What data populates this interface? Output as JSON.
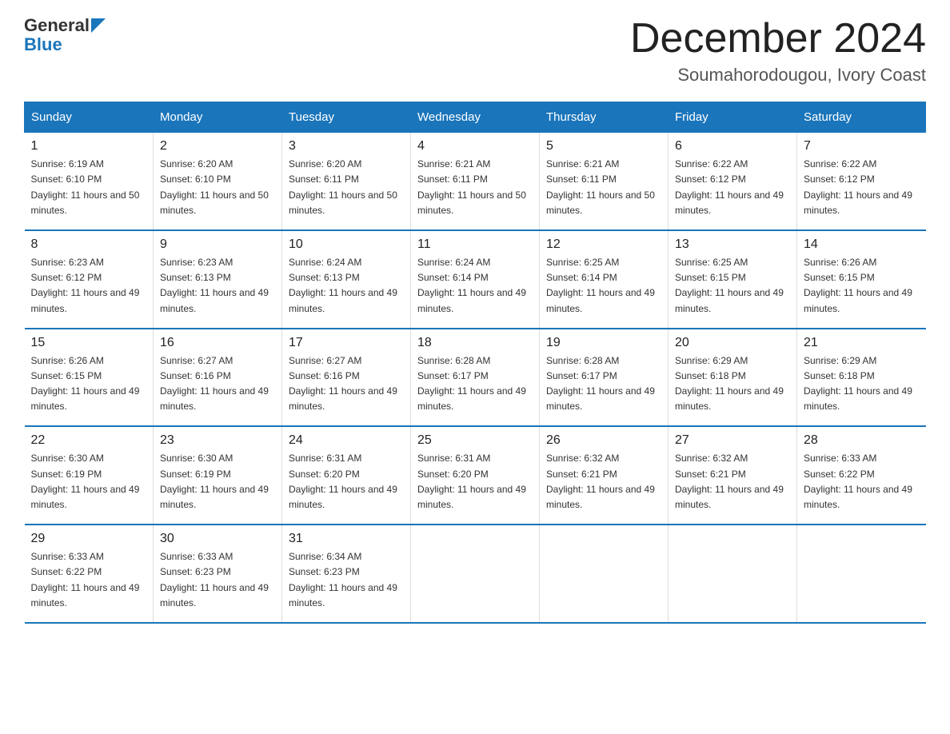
{
  "logo": {
    "text_general": "General",
    "text_blue": "Blue",
    "aria": "GeneralBlue logo"
  },
  "title": "December 2024",
  "subtitle": "Soumahorodougou, Ivory Coast",
  "headers": [
    "Sunday",
    "Monday",
    "Tuesday",
    "Wednesday",
    "Thursday",
    "Friday",
    "Saturday"
  ],
  "weeks": [
    [
      {
        "day": "1",
        "sunrise": "6:19 AM",
        "sunset": "6:10 PM",
        "daylight": "11 hours and 50 minutes."
      },
      {
        "day": "2",
        "sunrise": "6:20 AM",
        "sunset": "6:10 PM",
        "daylight": "11 hours and 50 minutes."
      },
      {
        "day": "3",
        "sunrise": "6:20 AM",
        "sunset": "6:11 PM",
        "daylight": "11 hours and 50 minutes."
      },
      {
        "day": "4",
        "sunrise": "6:21 AM",
        "sunset": "6:11 PM",
        "daylight": "11 hours and 50 minutes."
      },
      {
        "day": "5",
        "sunrise": "6:21 AM",
        "sunset": "6:11 PM",
        "daylight": "11 hours and 50 minutes."
      },
      {
        "day": "6",
        "sunrise": "6:22 AM",
        "sunset": "6:12 PM",
        "daylight": "11 hours and 49 minutes."
      },
      {
        "day": "7",
        "sunrise": "6:22 AM",
        "sunset": "6:12 PM",
        "daylight": "11 hours and 49 minutes."
      }
    ],
    [
      {
        "day": "8",
        "sunrise": "6:23 AM",
        "sunset": "6:12 PM",
        "daylight": "11 hours and 49 minutes."
      },
      {
        "day": "9",
        "sunrise": "6:23 AM",
        "sunset": "6:13 PM",
        "daylight": "11 hours and 49 minutes."
      },
      {
        "day": "10",
        "sunrise": "6:24 AM",
        "sunset": "6:13 PM",
        "daylight": "11 hours and 49 minutes."
      },
      {
        "day": "11",
        "sunrise": "6:24 AM",
        "sunset": "6:14 PM",
        "daylight": "11 hours and 49 minutes."
      },
      {
        "day": "12",
        "sunrise": "6:25 AM",
        "sunset": "6:14 PM",
        "daylight": "11 hours and 49 minutes."
      },
      {
        "day": "13",
        "sunrise": "6:25 AM",
        "sunset": "6:15 PM",
        "daylight": "11 hours and 49 minutes."
      },
      {
        "day": "14",
        "sunrise": "6:26 AM",
        "sunset": "6:15 PM",
        "daylight": "11 hours and 49 minutes."
      }
    ],
    [
      {
        "day": "15",
        "sunrise": "6:26 AM",
        "sunset": "6:15 PM",
        "daylight": "11 hours and 49 minutes."
      },
      {
        "day": "16",
        "sunrise": "6:27 AM",
        "sunset": "6:16 PM",
        "daylight": "11 hours and 49 minutes."
      },
      {
        "day": "17",
        "sunrise": "6:27 AM",
        "sunset": "6:16 PM",
        "daylight": "11 hours and 49 minutes."
      },
      {
        "day": "18",
        "sunrise": "6:28 AM",
        "sunset": "6:17 PM",
        "daylight": "11 hours and 49 minutes."
      },
      {
        "day": "19",
        "sunrise": "6:28 AM",
        "sunset": "6:17 PM",
        "daylight": "11 hours and 49 minutes."
      },
      {
        "day": "20",
        "sunrise": "6:29 AM",
        "sunset": "6:18 PM",
        "daylight": "11 hours and 49 minutes."
      },
      {
        "day": "21",
        "sunrise": "6:29 AM",
        "sunset": "6:18 PM",
        "daylight": "11 hours and 49 minutes."
      }
    ],
    [
      {
        "day": "22",
        "sunrise": "6:30 AM",
        "sunset": "6:19 PM",
        "daylight": "11 hours and 49 minutes."
      },
      {
        "day": "23",
        "sunrise": "6:30 AM",
        "sunset": "6:19 PM",
        "daylight": "11 hours and 49 minutes."
      },
      {
        "day": "24",
        "sunrise": "6:31 AM",
        "sunset": "6:20 PM",
        "daylight": "11 hours and 49 minutes."
      },
      {
        "day": "25",
        "sunrise": "6:31 AM",
        "sunset": "6:20 PM",
        "daylight": "11 hours and 49 minutes."
      },
      {
        "day": "26",
        "sunrise": "6:32 AM",
        "sunset": "6:21 PM",
        "daylight": "11 hours and 49 minutes."
      },
      {
        "day": "27",
        "sunrise": "6:32 AM",
        "sunset": "6:21 PM",
        "daylight": "11 hours and 49 minutes."
      },
      {
        "day": "28",
        "sunrise": "6:33 AM",
        "sunset": "6:22 PM",
        "daylight": "11 hours and 49 minutes."
      }
    ],
    [
      {
        "day": "29",
        "sunrise": "6:33 AM",
        "sunset": "6:22 PM",
        "daylight": "11 hours and 49 minutes."
      },
      {
        "day": "30",
        "sunrise": "6:33 AM",
        "sunset": "6:23 PM",
        "daylight": "11 hours and 49 minutes."
      },
      {
        "day": "31",
        "sunrise": "6:34 AM",
        "sunset": "6:23 PM",
        "daylight": "11 hours and 49 minutes."
      },
      null,
      null,
      null,
      null
    ]
  ],
  "sunrise_label": "Sunrise: ",
  "sunset_label": "Sunset: ",
  "daylight_label": "Daylight: "
}
